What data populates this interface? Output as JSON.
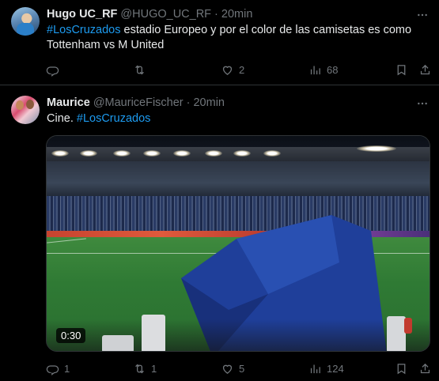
{
  "tweets": [
    {
      "name": "Hugo UC_RF",
      "handle": "@HUGO_UC_RF",
      "dot": "·",
      "time": "20min",
      "hashtag": "#LosCruzados",
      "text": " estadio Europeo y por el color de las camisetas es como Tottenham vs M United",
      "replies": "",
      "retweets": "",
      "likes": "2",
      "views": "68"
    },
    {
      "name": "Maurice",
      "handle": "@MauriceFischer",
      "dot": "·",
      "time": "20min",
      "text_prefix": "Cine. ",
      "hashtag": "#LosCruzados",
      "video_duration": "0:30",
      "replies": "1",
      "retweets": "1",
      "likes": "5",
      "views": "124"
    }
  ],
  "icons": {
    "reply": "reply-icon",
    "retweet": "retweet-icon",
    "like": "heart-icon",
    "views": "views-chart-icon",
    "bookmark": "bookmark-icon",
    "share": "share-icon",
    "more": "more-dots-icon"
  },
  "colors": {
    "background": "#000000",
    "text": "#e7e9ea",
    "muted": "#71767b",
    "accent": "#1d9bf0",
    "divider": "#2f3336"
  }
}
